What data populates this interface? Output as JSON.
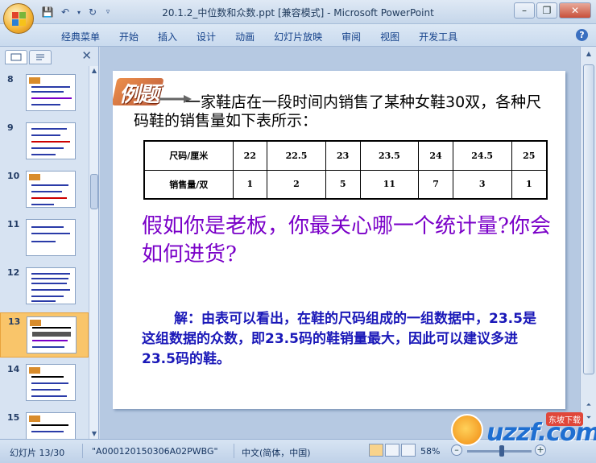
{
  "window": {
    "title": "20.1.2_中位数和众数.ppt [兼容模式] - Microsoft PowerPoint"
  },
  "ribbon": {
    "tabs": [
      "经典菜单",
      "开始",
      "插入",
      "设计",
      "动画",
      "幻灯片放映",
      "审阅",
      "视图",
      "开发工具"
    ]
  },
  "thumbnails": {
    "numbers": [
      "8",
      "9",
      "10",
      "11",
      "12",
      "13",
      "14",
      "15"
    ],
    "selected": "13"
  },
  "slide": {
    "badge": "例题",
    "intro": "一家鞋店在一段时间内销售了某种女鞋30双，各种尺码鞋的销售量如下表所示：",
    "table": {
      "rows": [
        {
          "header": "尺码/厘米",
          "cells": [
            "22",
            "22.5",
            "23",
            "23.5",
            "24",
            "24.5",
            "25"
          ]
        },
        {
          "header": "销售量/双",
          "cells": [
            "1",
            "2",
            "5",
            "11",
            "7",
            "3",
            "1"
          ]
        }
      ]
    },
    "question": "假如你是老板，你最关心哪一个统计量?你会如何进货?",
    "answer": "解：由表可以看出，在鞋的尺码组成的一组数据中，23.5是这组数据的众数，即23.5码的鞋销量最大，因此可以建议多进23.5码的鞋。"
  },
  "statusbar": {
    "slide_info": "幻灯片 13/30",
    "theme": "\"A000120150306A02PWBG\"",
    "language": "中文(简体，中国)",
    "zoom": "58%"
  },
  "watermark": {
    "text": "uzzf.com",
    "tag": "东坡下载"
  },
  "colors": {
    "question": "#7a00c8",
    "answer": "#1a18b8",
    "selected_thumb": "#f9c56a"
  }
}
